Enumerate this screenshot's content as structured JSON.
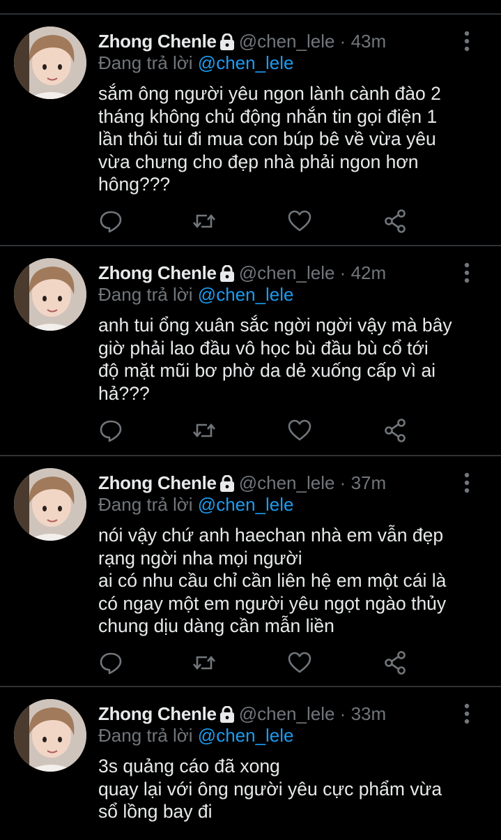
{
  "colors": {
    "background": "#000000",
    "divider": "#2f3336",
    "primary_text": "#e7e9ea",
    "secondary_text": "#71767b",
    "link": "#1d9bf0"
  },
  "icons": {
    "lock": "lock-icon",
    "more": "more-vertical-icon",
    "reply": "reply-icon",
    "retweet": "retweet-icon",
    "like": "heart-icon",
    "share": "share-icon"
  },
  "tweets": [
    {
      "name": "Zhong Chenle",
      "handle": "@chen_lele",
      "sep": "·",
      "time": "43m",
      "reply_prefix": "Đang trả lời",
      "reply_to": "@chen_lele",
      "text": "sắm ông người yêu ngon lành cành đào 2\ntháng không chủ động nhắn tin gọi điện 1\nlần thôi tui đi mua con búp bê về vừa yêu\nvừa chưng cho đẹp nhà phải ngon hơn\nhông???"
    },
    {
      "name": "Zhong Chenle",
      "handle": "@chen_lele",
      "sep": "·",
      "time": "42m",
      "reply_prefix": "Đang trả lời",
      "reply_to": "@chen_lele",
      "text": "anh tui ổng xuân sắc ngời ngời vậy mà bây\ngiờ phải lao đầu vô học bù đầu bù cổ tới\nđộ mặt mũi bơ phờ da dẻ xuống cấp vì ai\nhả???"
    },
    {
      "name": "Zhong Chenle",
      "handle": "@chen_lele",
      "sep": "·",
      "time": "37m",
      "reply_prefix": "Đang trả lời",
      "reply_to": "@chen_lele",
      "text": "nói vậy chứ anh haechan nhà em vẫn đẹp\nrạng ngời nha mọi người\nai có nhu cầu chỉ cần liên hệ em một cái là\ncó ngay một em người yêu ngọt ngào thủy\nchung dịu dàng cần mẫn liền"
    },
    {
      "name": "Zhong Chenle",
      "handle": "@chen_lele",
      "sep": "·",
      "time": "33m",
      "reply_prefix": "Đang trả lời",
      "reply_to": "@chen_lele",
      "text": "3s quảng cáo đã xong\nquay lại với ông người yêu cực phẩm vừa\nsổ lồng bay đi"
    }
  ]
}
